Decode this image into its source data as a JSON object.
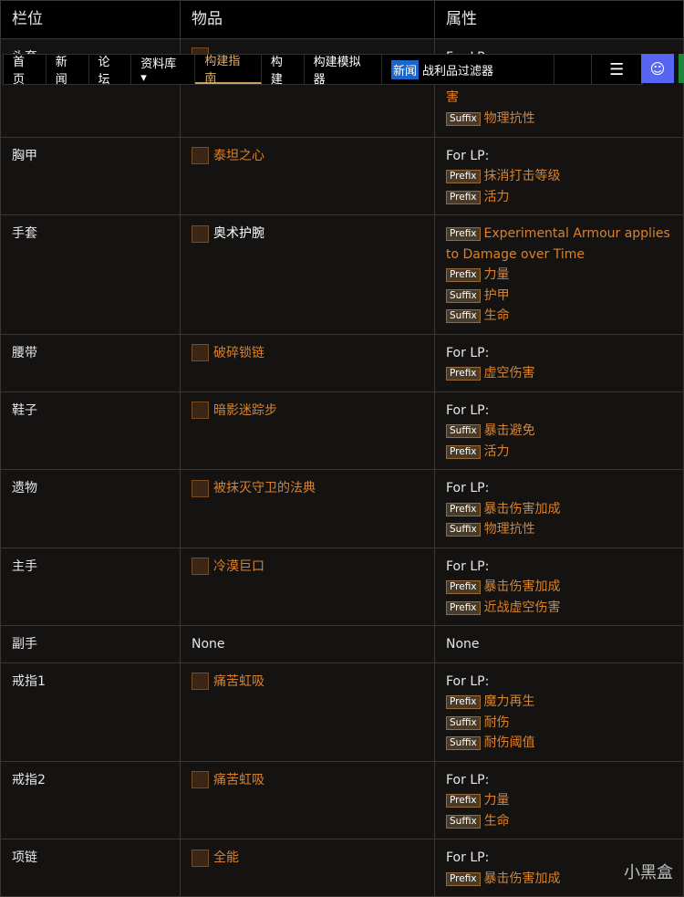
{
  "headers": [
    "栏位",
    "物品",
    "属性"
  ],
  "rows": [
    {
      "slot": "头套",
      "item": "",
      "lines": [
        {
          "t": "For LP:"
        },
        {
          "t": ""
        },
        {
          "t": "害"
        },
        {
          "b": "Suffix",
          "t": "物理抗性"
        }
      ]
    },
    {
      "slot": "胸甲",
      "item": "泰坦之心",
      "lines": [
        {
          "t": "For LP:"
        },
        {
          "b": "Prefix",
          "t": "抹消打击等级"
        },
        {
          "b": "Prefix",
          "t": "活力"
        }
      ]
    },
    {
      "slot": "手套",
      "item": "奥术护腕",
      "white": true,
      "lines": [
        {
          "b": "Prefix",
          "t": "Experimental Armour applies to Damage over Time"
        },
        {
          "b": "Prefix",
          "t": "力量"
        },
        {
          "b": "Suffix",
          "t": "护甲"
        },
        {
          "b": "Suffix",
          "t": "生命"
        }
      ]
    },
    {
      "slot": "腰带",
      "item": "破碎锁链",
      "lines": [
        {
          "t": "For LP:"
        },
        {
          "b": "Prefix",
          "t": "虚空伤害"
        }
      ]
    },
    {
      "slot": "鞋子",
      "item": "暗影迷踪步",
      "lines": [
        {
          "t": "For LP:"
        },
        {
          "b": "Suffix",
          "t": "暴击避免"
        },
        {
          "b": "Prefix",
          "t": "活力"
        }
      ]
    },
    {
      "slot": "遗物",
      "item": "被抹灭守卫的法典",
      "lines": [
        {
          "t": "For LP:"
        },
        {
          "b": "Prefix",
          "t": "暴击伤害加成"
        },
        {
          "b": "Suffix",
          "t": "物理抗性"
        }
      ]
    },
    {
      "slot": "主手",
      "item": "冷漠巨口",
      "lines": [
        {
          "t": "For LP:"
        },
        {
          "b": "Prefix",
          "t": "暴击伤害加成"
        },
        {
          "b": "Prefix",
          "t": "近战虚空伤害"
        }
      ]
    },
    {
      "slot": "副手",
      "item": "None",
      "none": true,
      "lines": [
        {
          "t": "None"
        }
      ]
    },
    {
      "slot": "戒指1",
      "item": "痛苦虹吸",
      "lines": [
        {
          "t": "For LP:"
        },
        {
          "b": "Prefix",
          "t": "魔力再生"
        },
        {
          "b": "Suffix",
          "t": "耐伤"
        },
        {
          "b": "Suffix",
          "t": "耐伤阈值"
        }
      ]
    },
    {
      "slot": "戒指2",
      "item": "痛苦虹吸",
      "lines": [
        {
          "t": "For LP:"
        },
        {
          "b": "Prefix",
          "t": "力量"
        },
        {
          "b": "Suffix",
          "t": "生命"
        }
      ]
    },
    {
      "slot": "项链",
      "item": "全能",
      "lines": [
        {
          "t": "For LP:"
        },
        {
          "b": "Prefix",
          "t": "暴击伤害加成"
        }
      ]
    }
  ],
  "nav": {
    "items": [
      "首页",
      "新闻",
      "论坛",
      "资料库 ▾",
      "构建指南",
      "构建",
      "构建模拟器"
    ],
    "active": 4,
    "new_badge": "新闻",
    "loot_filter": "战利品过滤器",
    "menu_icon": "hamburger-icon",
    "discord_icon": "discord-icon"
  },
  "watermark": "小黑盒"
}
